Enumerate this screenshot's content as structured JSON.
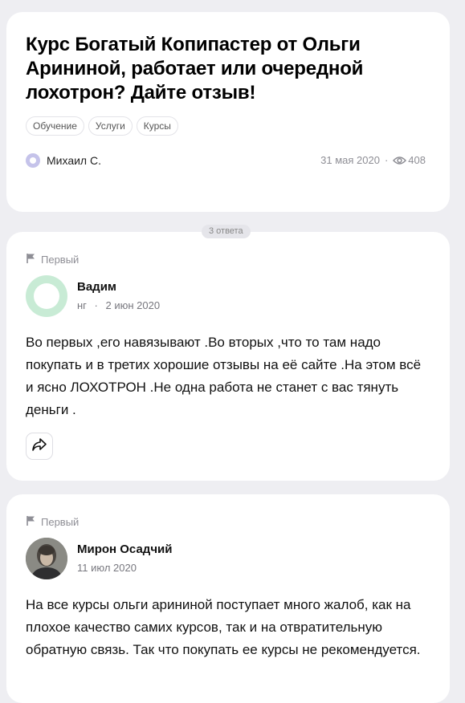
{
  "question": {
    "title": "Курс Богатый Копипастер от Ольги Арининой, работает или очередной лохотрон? Дайте отзыв!",
    "tags": [
      "Обучение",
      "Услуги",
      "Курсы"
    ],
    "author": "Михаил С.",
    "date": "31 мая 2020",
    "separator": "·",
    "views": "408"
  },
  "answers_count": "3 ответа",
  "answers": [
    {
      "badge": "Первый",
      "name": "Вадим",
      "subtitle": "нг",
      "separator": "·",
      "date": "2 июн 2020",
      "text": "Во первых ,его навязывают .Во вторых ,что то там надо покупать и в третих хорошие отзывы на её сайте .На этом всё и ясно ЛОХОТРОН .Не одна работа не станет с вас тянуть деньги ."
    },
    {
      "badge": "Первый",
      "name": "Мирон Осадчий",
      "date": "11 июл 2020",
      "text": "На все курсы ольги арининой поступает много жалоб, как на плохое качество самих курсов, так и на отвратительную обратную связь. Так что покупать ее курсы не рекомендуется."
    }
  ],
  "icons": {
    "views": "eye-icon",
    "badge": "flag-icon",
    "share": "share-icon"
  },
  "colors": {
    "background": "#eeeef2",
    "card": "#ffffff",
    "muted_text": "#8e8e95",
    "avatar_green": "#c8ebd5",
    "avatar_purple": "#c5c3ea"
  }
}
